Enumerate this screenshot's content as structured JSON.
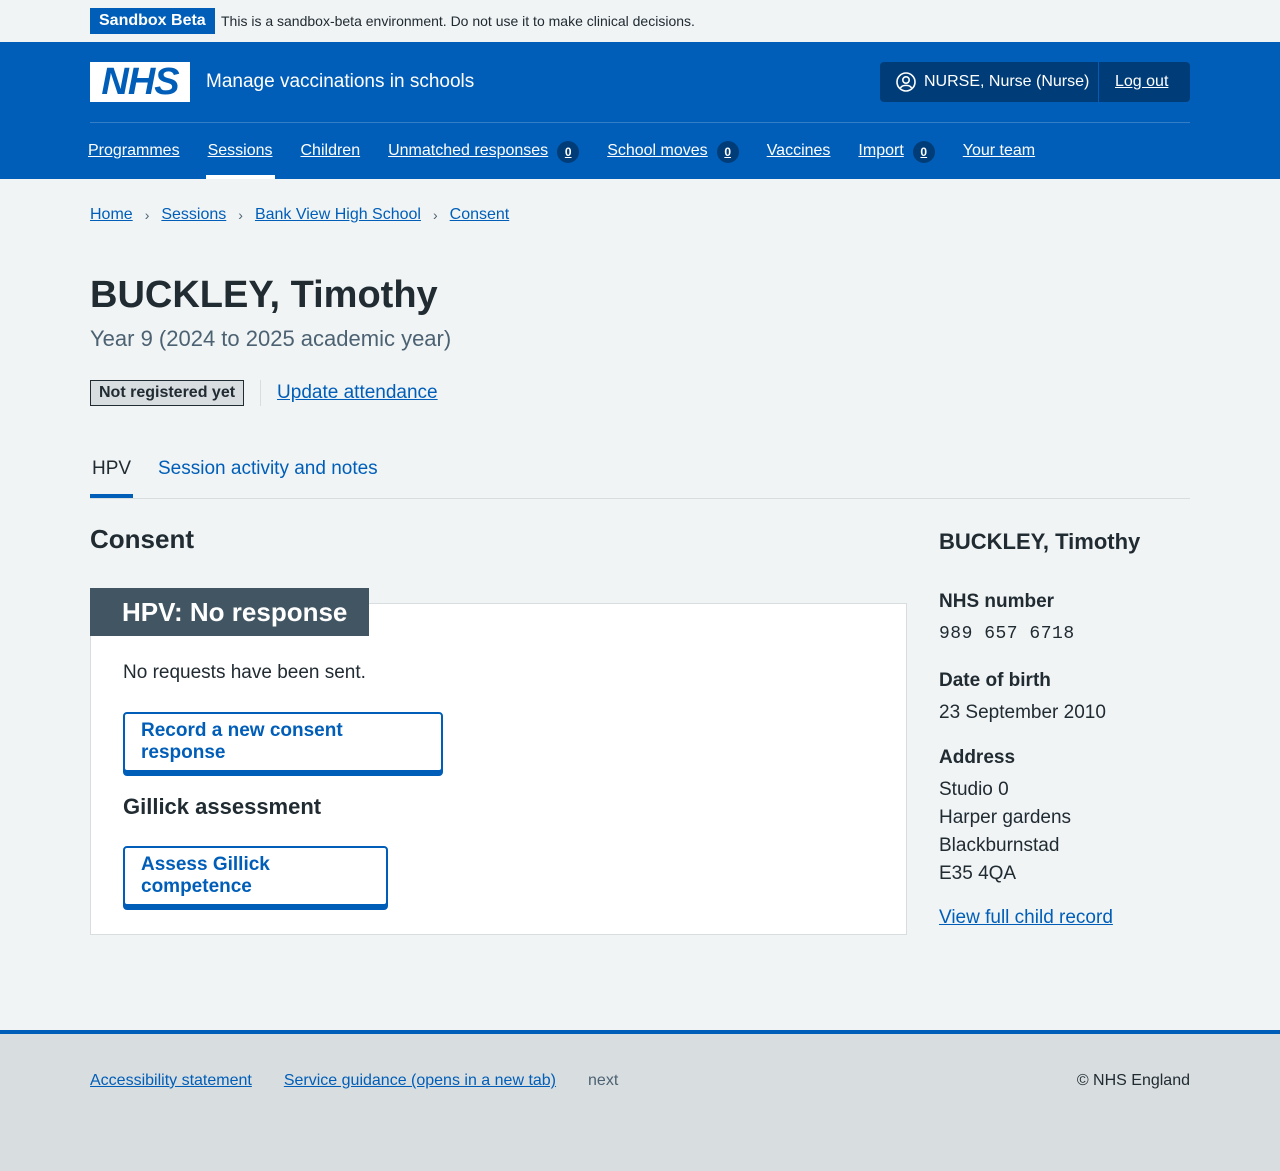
{
  "sandbox": {
    "tag": "Sandbox Beta",
    "message": "This is a sandbox-beta environment. Do not use it to make clinical decisions."
  },
  "header": {
    "logo": "NHS",
    "service_name": "Manage vaccinations in schools",
    "user": "NURSE, Nurse (Nurse)",
    "logout": "Log out"
  },
  "nav": {
    "items": [
      {
        "label": "Programmes"
      },
      {
        "label": "Sessions"
      },
      {
        "label": "Children"
      },
      {
        "label": "Unmatched responses",
        "count": "0"
      },
      {
        "label": "School moves",
        "count": "0"
      },
      {
        "label": "Vaccines"
      },
      {
        "label": "Import",
        "count": "0"
      },
      {
        "label": "Your team"
      }
    ]
  },
  "breadcrumb": [
    "Home",
    "Sessions",
    "Bank View High School",
    "Consent"
  ],
  "page": {
    "title": "BUCKLEY, Timothy",
    "caption": "Year 9 (2024 to 2025 academic year)",
    "registration_status": "Not registered yet",
    "update_attendance": "Update attendance"
  },
  "tabs": [
    "HPV",
    "Session activity and notes"
  ],
  "consent": {
    "heading": "Consent",
    "card_title": "HPV: No response",
    "message": "No requests have been sent.",
    "record_button": "Record a new consent response",
    "gillick_heading": "Gillick assessment",
    "gillick_button": "Assess Gillick competence"
  },
  "sidebar": {
    "name": "BUCKLEY, Timothy",
    "nhs_number_label": "NHS number",
    "nhs_number": "989 657 6718",
    "dob_label": "Date of birth",
    "dob": "23 September 2010",
    "address_label": "Address",
    "address": [
      "Studio 0",
      "Harper gardens",
      "Blackburnstad",
      "E35 4QA"
    ],
    "record_link": "View full child record"
  },
  "footer": {
    "links": [
      "Accessibility statement",
      "Service guidance (opens in a new tab)"
    ],
    "version": "next",
    "copyright": "© NHS England"
  },
  "colors": {
    "brand_blue": "#005eb8",
    "dark_blue": "#003d78",
    "card_header": "#425563",
    "background": "#f0f4f5"
  }
}
